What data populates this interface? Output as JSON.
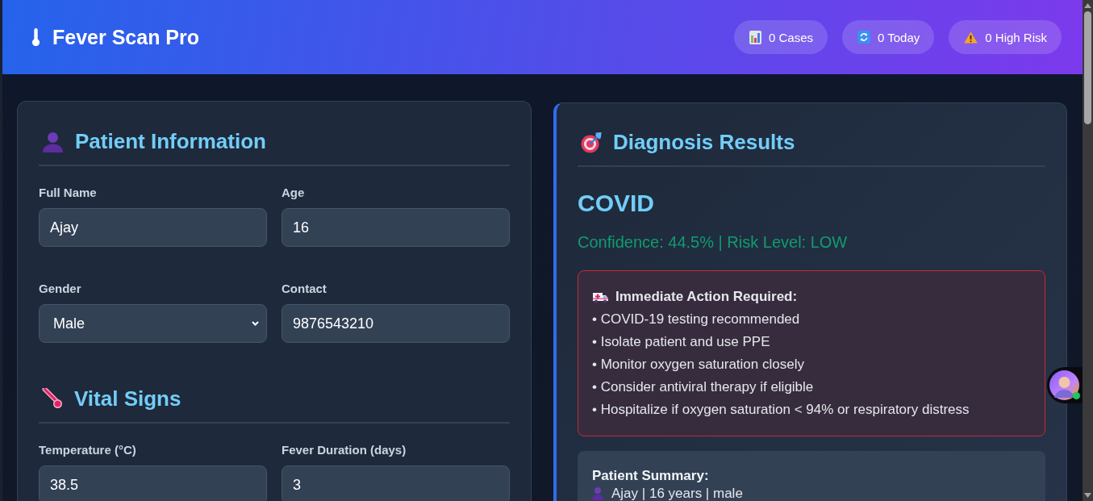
{
  "header": {
    "title": "Fever Scan Pro",
    "stats": [
      {
        "kind": "cases",
        "label": "0 Cases"
      },
      {
        "kind": "today",
        "label": "0 Today"
      },
      {
        "kind": "high_risk",
        "label": "0 High Risk"
      }
    ]
  },
  "patient_form": {
    "sections": [
      {
        "kind": "patient",
        "title": "Patient Information",
        "fields": [
          {
            "kind": "text",
            "label": "Full Name",
            "value": "Ajay"
          },
          {
            "kind": "text",
            "label": "Age",
            "value": "16"
          },
          {
            "kind": "select",
            "label": "Gender",
            "value": "Male"
          },
          {
            "kind": "text",
            "label": "Contact",
            "value": "9876543210"
          }
        ]
      },
      {
        "kind": "vitals",
        "title": "Vital Signs",
        "fields": [
          {
            "kind": "text",
            "label": "Temperature (°C)",
            "value": "38.5"
          },
          {
            "kind": "text",
            "label": "Fever Duration (days)",
            "value": "3"
          }
        ]
      }
    ]
  },
  "diagnosis": {
    "title": "Diagnosis Results",
    "result": "COVID",
    "confidence_text": "Confidence: 44.5% | Risk Level: LOW",
    "alert": {
      "title": "Immediate Action Required:",
      "items": [
        "• COVID-19 testing recommended",
        "• Isolate patient and use PPE",
        "• Monitor oxygen saturation closely",
        "• Consider antiviral therapy if eligible",
        "• Hospitalize if oxygen saturation < 94% or respiratory distress"
      ]
    },
    "summary": {
      "title": "Patient Summary:",
      "text": "Ajay | 16 years | male"
    }
  }
}
